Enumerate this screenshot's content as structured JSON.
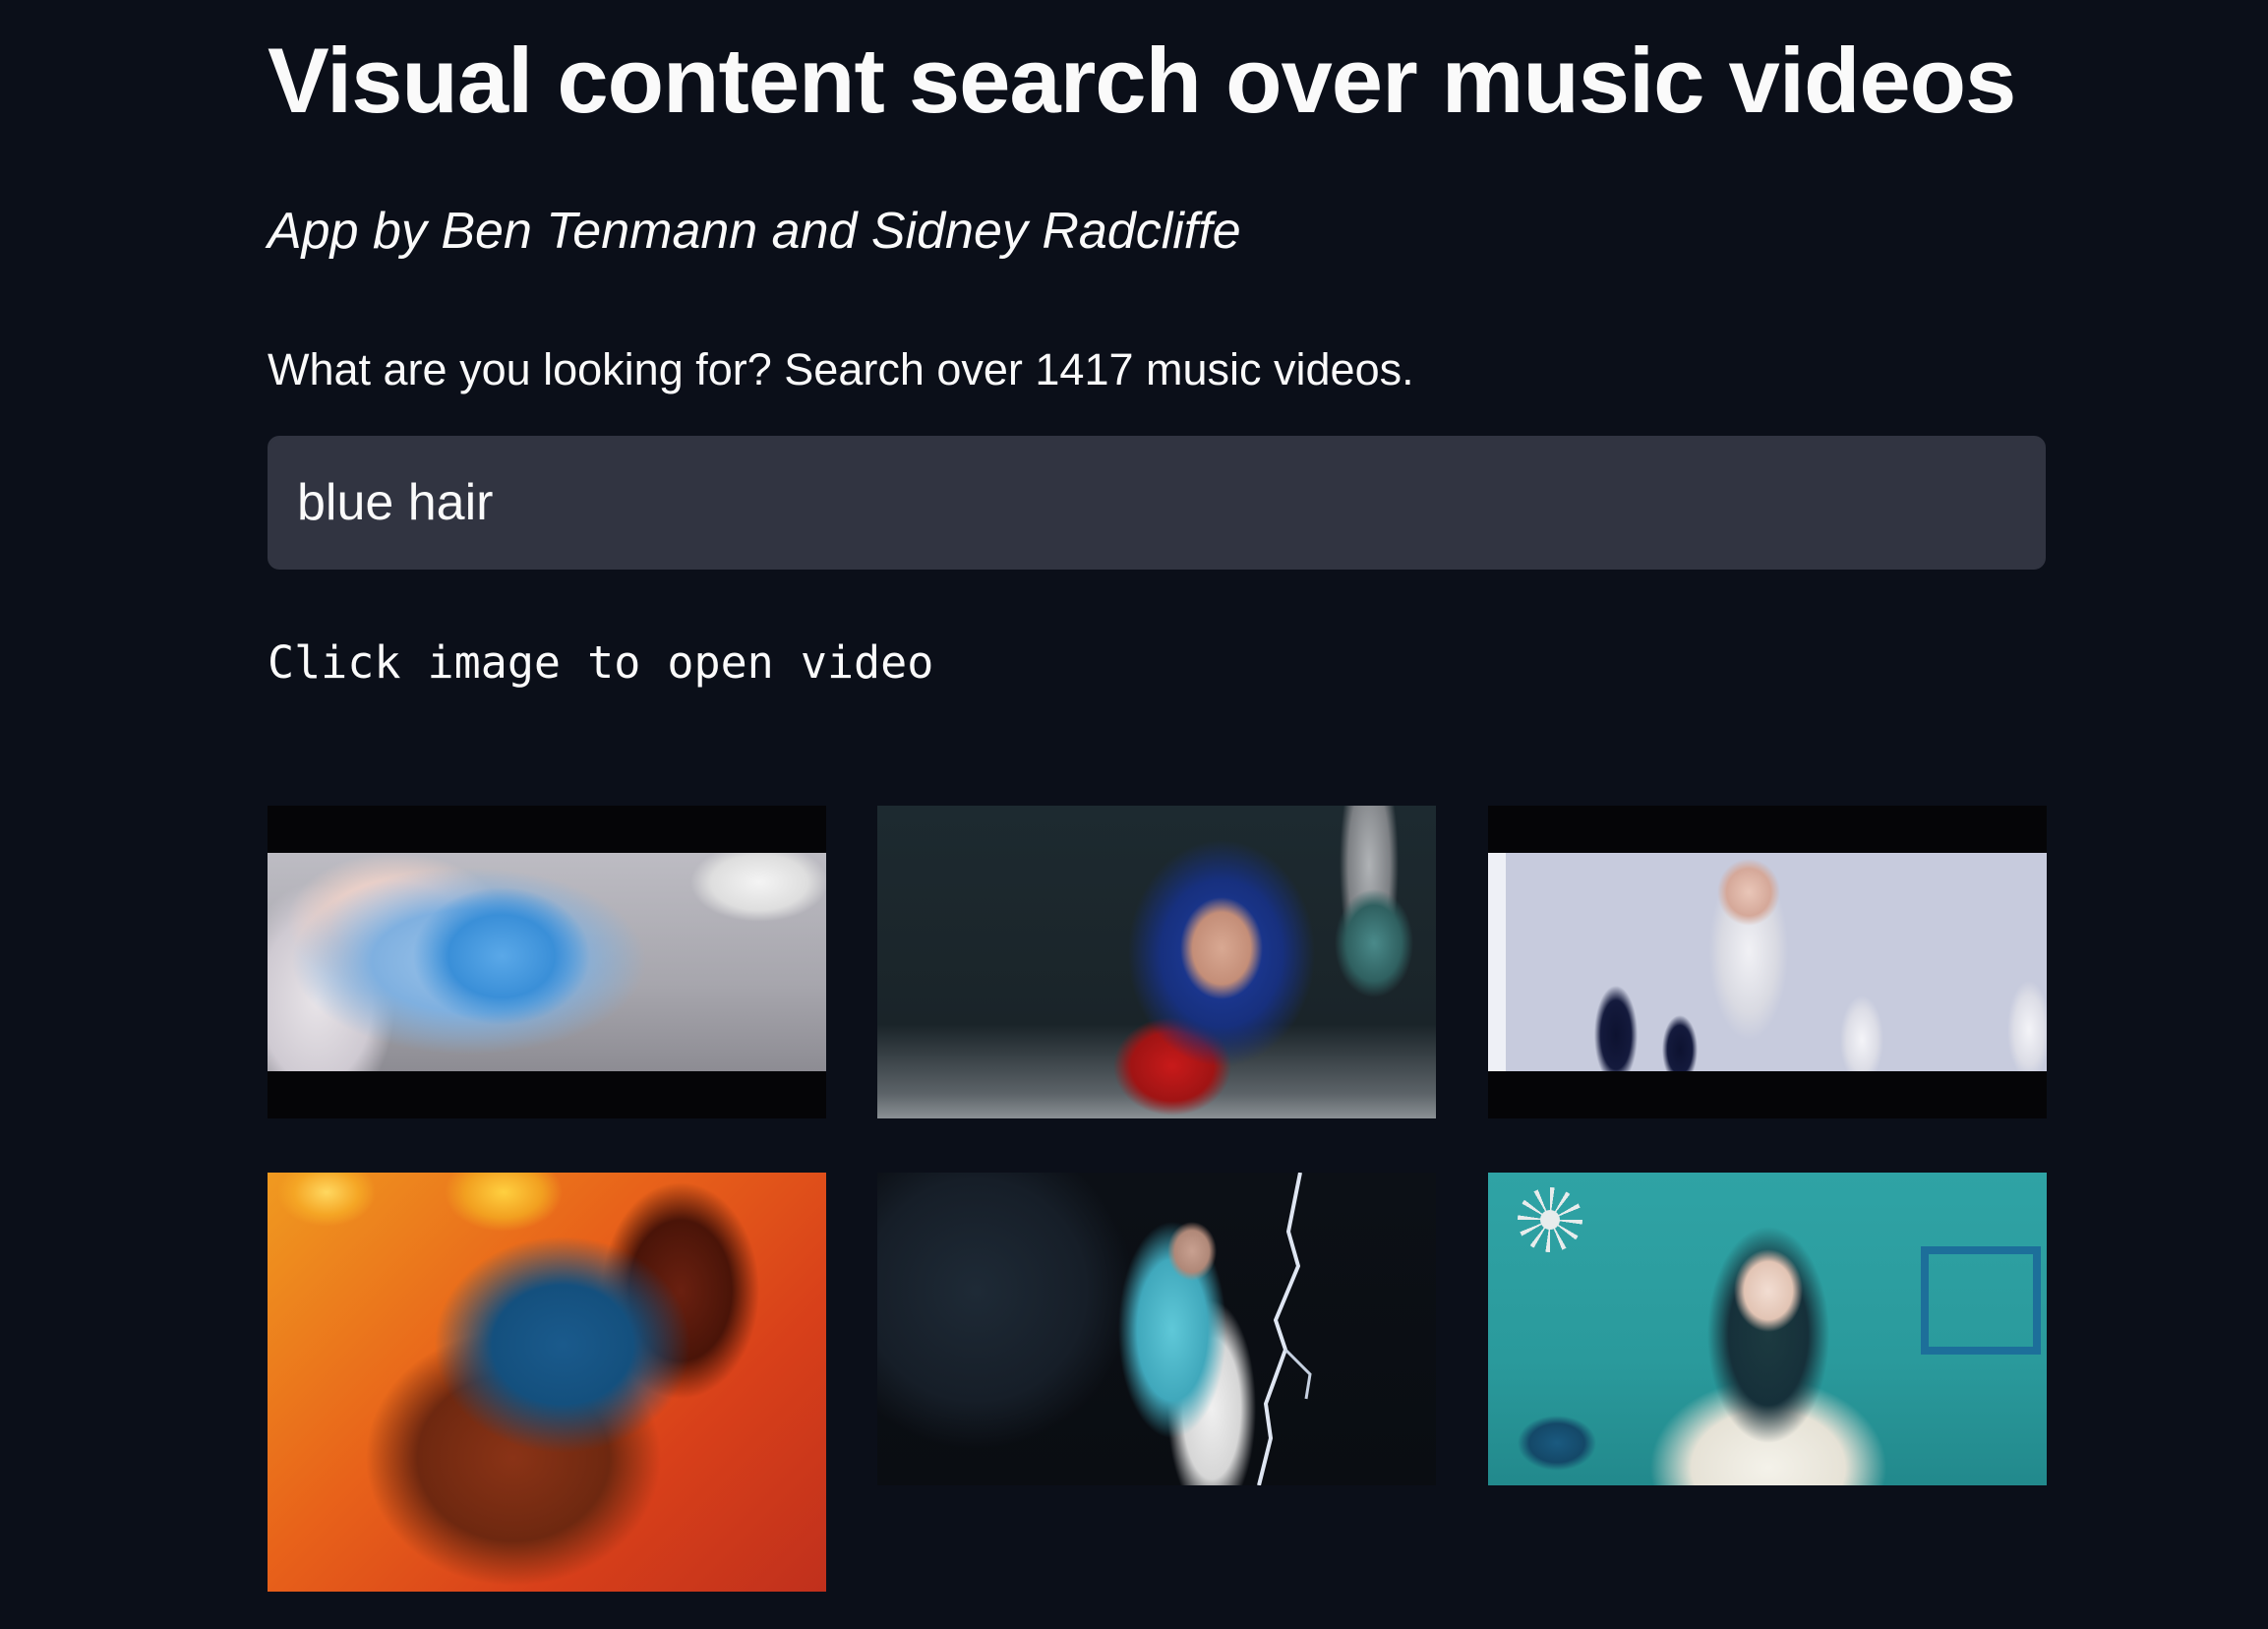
{
  "header": {
    "title": "Visual content search over music videos",
    "byline": "App by Ben Tenmann and Sidney Radcliffe"
  },
  "search": {
    "prompt": "What are you looking for? Search over 1417 music videos.",
    "value": "blue hair"
  },
  "results": {
    "hint": "Click image to open video",
    "items": [
      {
        "scene": "blue-haired singer lying down wearing blue headphones"
      },
      {
        "scene": "woman with blue bangs wig and red top"
      },
      {
        "scene": "blue-haired singer standing among chess pieces"
      },
      {
        "scene": "head with blue hair against orange background"
      },
      {
        "scene": "singer with long turquoise hair and lightning"
      },
      {
        "scene": "singer with dark teal hair in teal room"
      }
    ]
  },
  "colors": {
    "background": "#0b0f19",
    "input_background": "#313441",
    "text": "#fafafa"
  }
}
